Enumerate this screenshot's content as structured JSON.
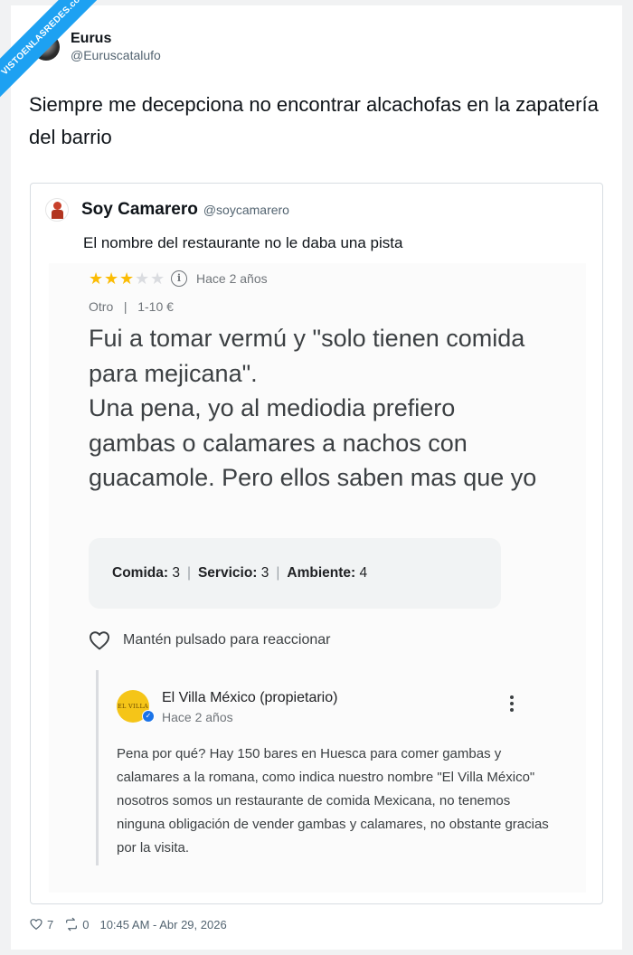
{
  "watermark": {
    "text": "VISTOENLASREDES.com"
  },
  "tweet": {
    "author_name": "Eurus",
    "author_handle": "@Euruscatalufo",
    "text": "Siempre me decepciona no encontrar alcachofas en la zapatería del barrio",
    "likes": "7",
    "retweets": "0",
    "timestamp": "10:45 AM - Abr 29, 2026"
  },
  "quote": {
    "author_name": "Soy Camarero",
    "author_handle": "@soycamarero",
    "text": "El nombre del restaurante no le daba una pista"
  },
  "review": {
    "rating": 3,
    "rating_max": 5,
    "time_ago": "Hace 2 años",
    "category": "Otro",
    "price": "1-10 €",
    "body": "Fui a tomar vermú y \"solo tienen comida para mejicana\".\nUna pena, yo al mediodia prefiero gambas o calamares a nachos con guacamole.  Pero ellos saben mas que yo",
    "scores": {
      "food_label": "Comida:",
      "food_value": "3",
      "service_label": "Servicio:",
      "service_value": "3",
      "ambience_label": "Ambiente:",
      "ambience_value": "4"
    },
    "react_label": "Mantén pulsado para reaccionar"
  },
  "owner_reply": {
    "avatar_text": "EL VILLA",
    "name": "El Villa México (propietario)",
    "time_ago": "Hace 2 años",
    "text": "Pena por qué? Hay 150 bares en Huesca para comer gambas y calamares a la romana, como indica nuestro nombre \"El Villa México\" nosotros somos un restaurante de comida Mexicana, no tenemos ninguna obligación de vender gambas y calamares, no obstante gracias por la visita."
  },
  "colors": {
    "star_on": "#fbbc04",
    "star_off": "#dadce0",
    "verified": "#1a73e8",
    "badge": "#1da1f2"
  }
}
